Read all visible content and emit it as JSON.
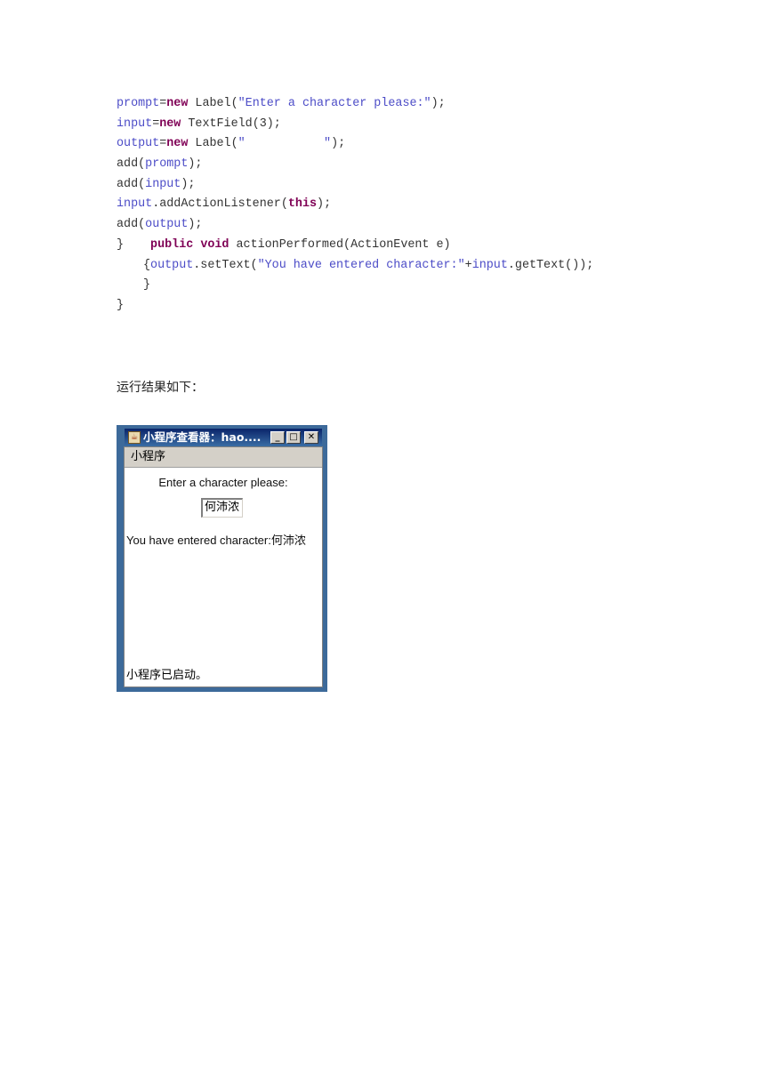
{
  "code": {
    "l1": {
      "var": "prompt",
      "op": "=",
      "kw": "new",
      "mid": " Label(",
      "str": "\"Enter a character please:\"",
      "end": ");"
    },
    "l2": {
      "var": "input",
      "op": "=",
      "kw": "new",
      "rest": " TextField(3);"
    },
    "l3": {
      "var": "output",
      "op": "=",
      "kw": "new",
      "mid": " Label(",
      "str": "\"           \"",
      "end": ");"
    },
    "l4": {
      "pre": "add(",
      "var": "prompt",
      "end": ");"
    },
    "l5": {
      "pre": "add(",
      "var": "input",
      "end": ");"
    },
    "l6": {
      "var": "input",
      "mid": ".addActionListener(",
      "kw": "this",
      "end": ");"
    },
    "l7": {
      "pre": "add(",
      "var": "output",
      "end": ");"
    },
    "l8": {
      "brace": "}",
      "kw1": "public",
      "kw2": "void",
      "rest": " actionPerformed(ActionEvent e)"
    },
    "l9": {
      "pre": "{",
      "var1": "output",
      "mid": ".setText(",
      "str": "\"You have entered character:\"",
      "plus": "+",
      "var2": "input",
      "end": ".getText());"
    },
    "l10": "}",
    "l11": "}"
  },
  "caption": "运行结果如下：",
  "applet": {
    "title": "小程序查看器：hao....",
    "menu": "小程序",
    "prompt": "Enter a character please:",
    "input_value": "何沛浓",
    "output": "You have entered character:何沛浓",
    "status": "小程序已启动。",
    "buttons": {
      "minimize": "_",
      "maximize": "□",
      "close": "✕"
    }
  }
}
